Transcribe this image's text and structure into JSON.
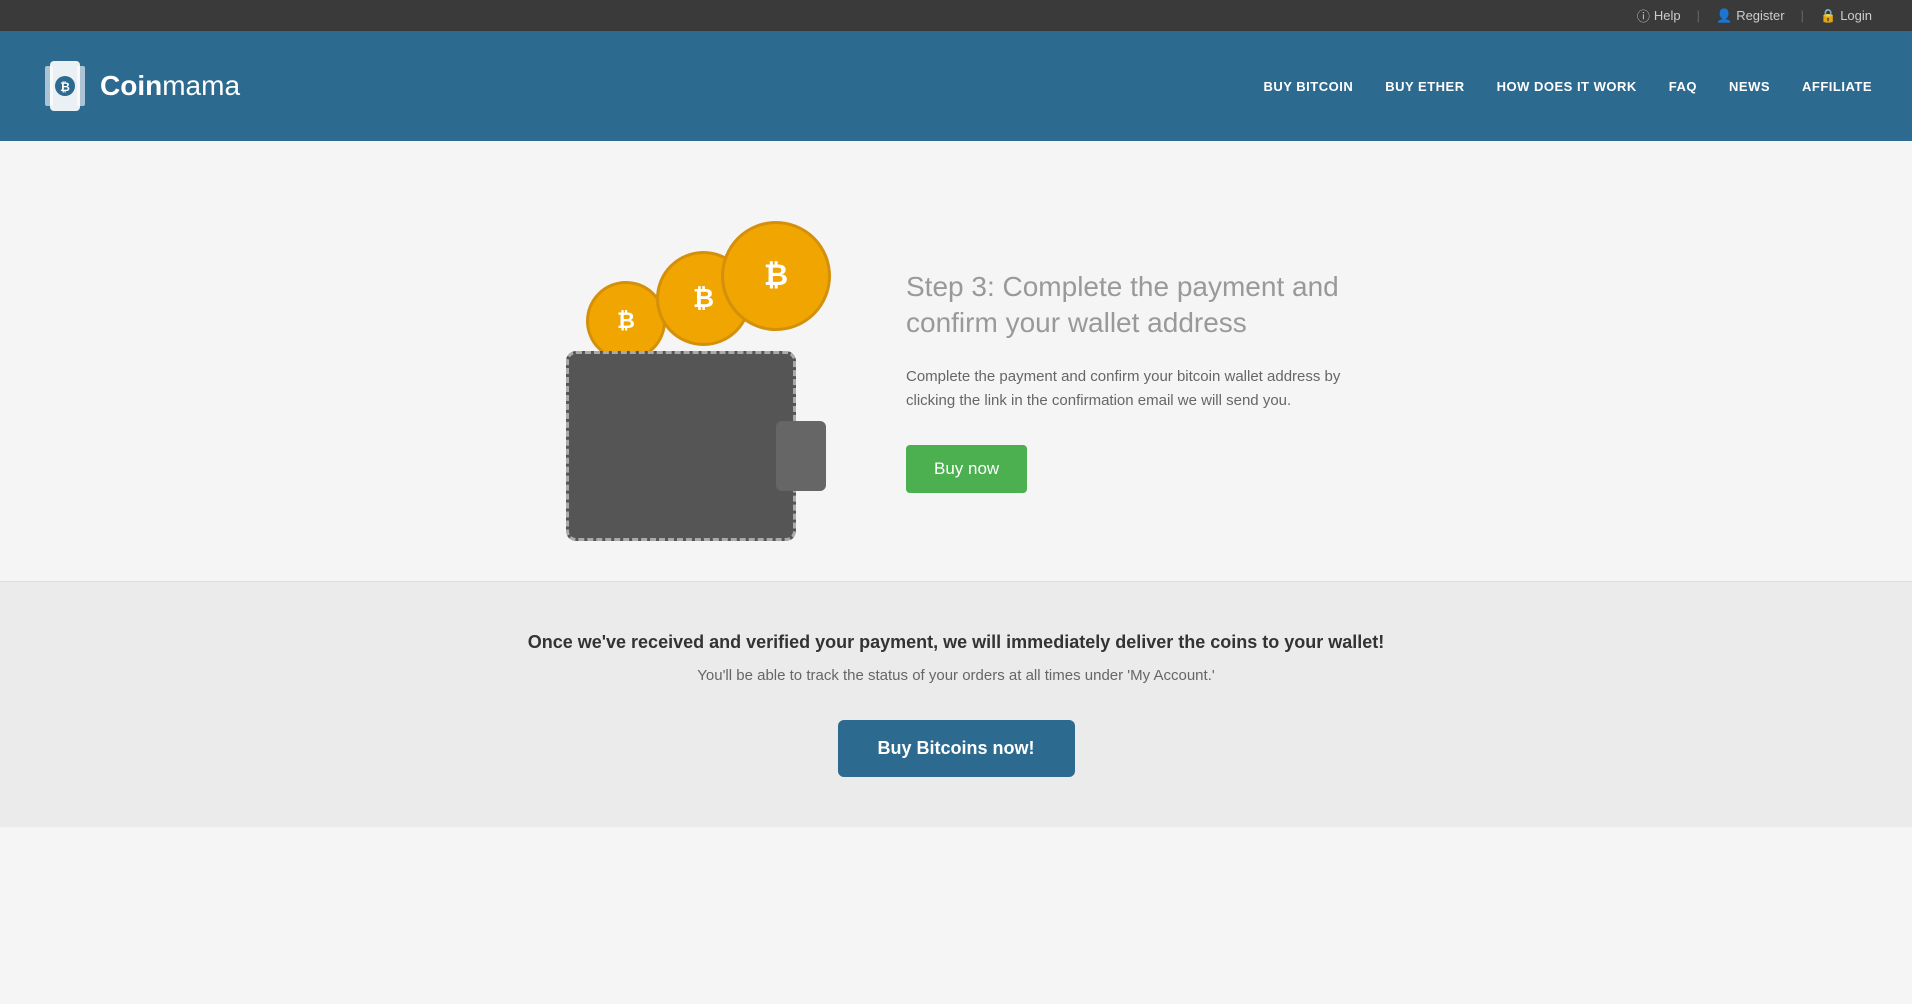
{
  "topbar": {
    "help_label": "Help",
    "register_label": "Register",
    "login_label": "Login"
  },
  "header": {
    "logo_text_bold": "Coin",
    "logo_text_light": "mama",
    "nav_items": [
      {
        "label": "BUY BITCOIN",
        "id": "buy-bitcoin"
      },
      {
        "label": "BUY ETHER",
        "id": "buy-ether"
      },
      {
        "label": "HOW DOES IT WORK",
        "id": "how-it-works"
      },
      {
        "label": "FAQ",
        "id": "faq"
      },
      {
        "label": "NEWS",
        "id": "news"
      },
      {
        "label": "AFFILIATE",
        "id": "affiliate"
      }
    ]
  },
  "step": {
    "heading": "Step 3: Complete the payment and confirm your wallet address",
    "description": "Complete the payment and confirm your bitcoin wallet address by clicking the link in the confirmation email we will send you.",
    "buy_now_label": "Buy now"
  },
  "bottom": {
    "main_text": "Once we've received and verified your payment, we will immediately deliver the coins to your wallet!",
    "sub_text": "You'll be able to track the status of your orders at all times under 'My Account.'",
    "cta_label": "Buy Bitcoins now!"
  },
  "colors": {
    "header_bg": "#2d6a8f",
    "top_bar_bg": "#3a3a3a",
    "buy_now_green": "#4caf50",
    "cta_blue": "#2d6a8f",
    "coin_orange": "#f0a500"
  }
}
